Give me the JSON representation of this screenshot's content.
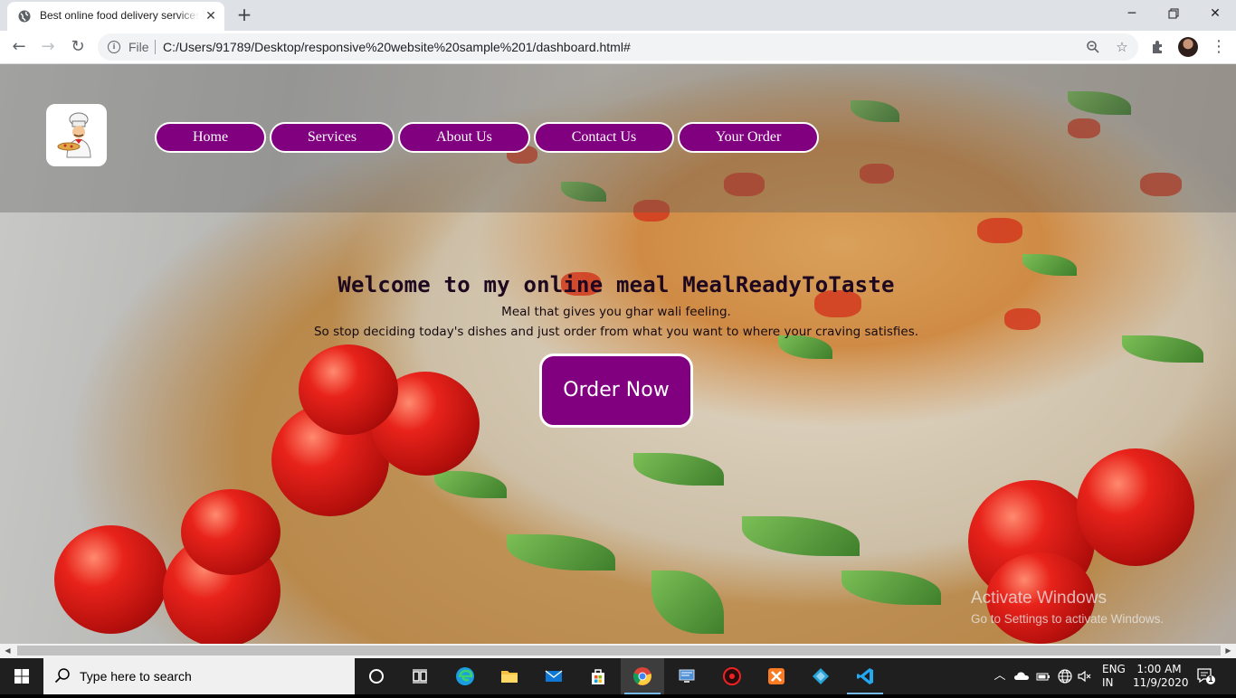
{
  "browser": {
    "tab_title": "Best online food delivery services",
    "url_scheme": "File",
    "url": "C:/Users/91789/Desktop/responsive%20website%20sample%201/dashboard.html#",
    "window_controls": {
      "minimize": "minimize-icon",
      "restore": "restore-icon",
      "close": "close-icon"
    }
  },
  "site": {
    "nav": [
      "Home",
      "Services",
      "About Us",
      "Contact Us",
      "Your Order"
    ],
    "welcome": "Welcome to my online meal MealReadyToTaste",
    "tagline_1": "Meal that gives you ghar wali feeling.",
    "tagline_2": "So stop deciding today's dishes and just order from what you want to where your craving satisfies.",
    "order_button": "Order Now",
    "brand_color": "#800080"
  },
  "watermark": {
    "title": "Activate Windows",
    "subtitle": "Go to Settings to activate Windows."
  },
  "taskbar": {
    "search_placeholder": "Type here to search",
    "apps": [
      "cortana-icon",
      "task-view-icon",
      "edge-icon",
      "file-explorer-icon",
      "mail-icon",
      "store-icon",
      "chrome-icon",
      "remote-desktop-icon",
      "app-red-icon",
      "xampp-icon",
      "app-diamond-icon",
      "vscode-icon"
    ],
    "language_1": "ENG",
    "language_2": "IN",
    "time": "1:00 AM",
    "date": "11/9/2020",
    "notification_count": "1"
  }
}
